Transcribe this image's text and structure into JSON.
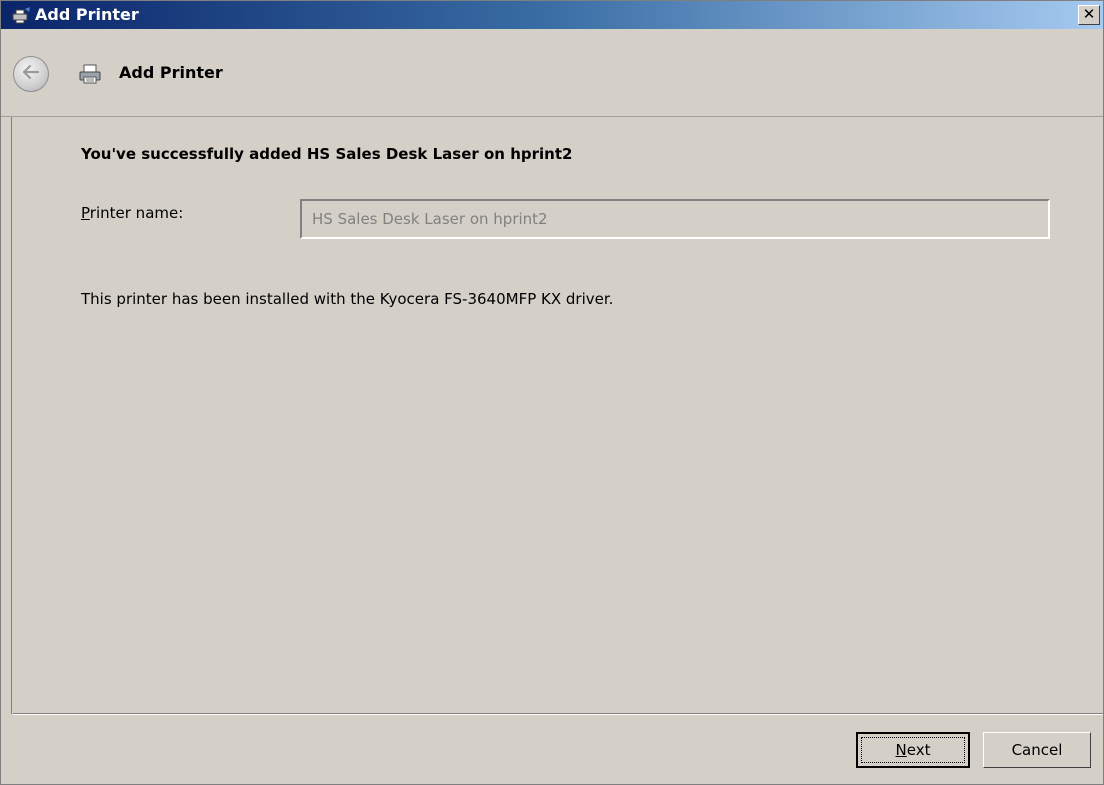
{
  "window": {
    "title": "Add Printer"
  },
  "titlebar": {
    "close_label": "✕"
  },
  "nav": {
    "title": "Add Printer"
  },
  "content": {
    "heading": "You've successfully added HS Sales Desk Laser on hprint2",
    "printer_name_label_accel": "P",
    "printer_name_label_rest": "rinter name:",
    "printer_name_value": "HS Sales Desk Laser on hprint2",
    "driver_text": "This printer has been installed with the Kyocera FS-3640MFP KX driver."
  },
  "footer": {
    "next_accel": "N",
    "next_rest": "ext",
    "cancel_label": "Cancel"
  },
  "icons": {
    "app": "printer-icon",
    "back": "back-arrow-icon",
    "nav": "printer-icon",
    "close": "close-icon"
  }
}
